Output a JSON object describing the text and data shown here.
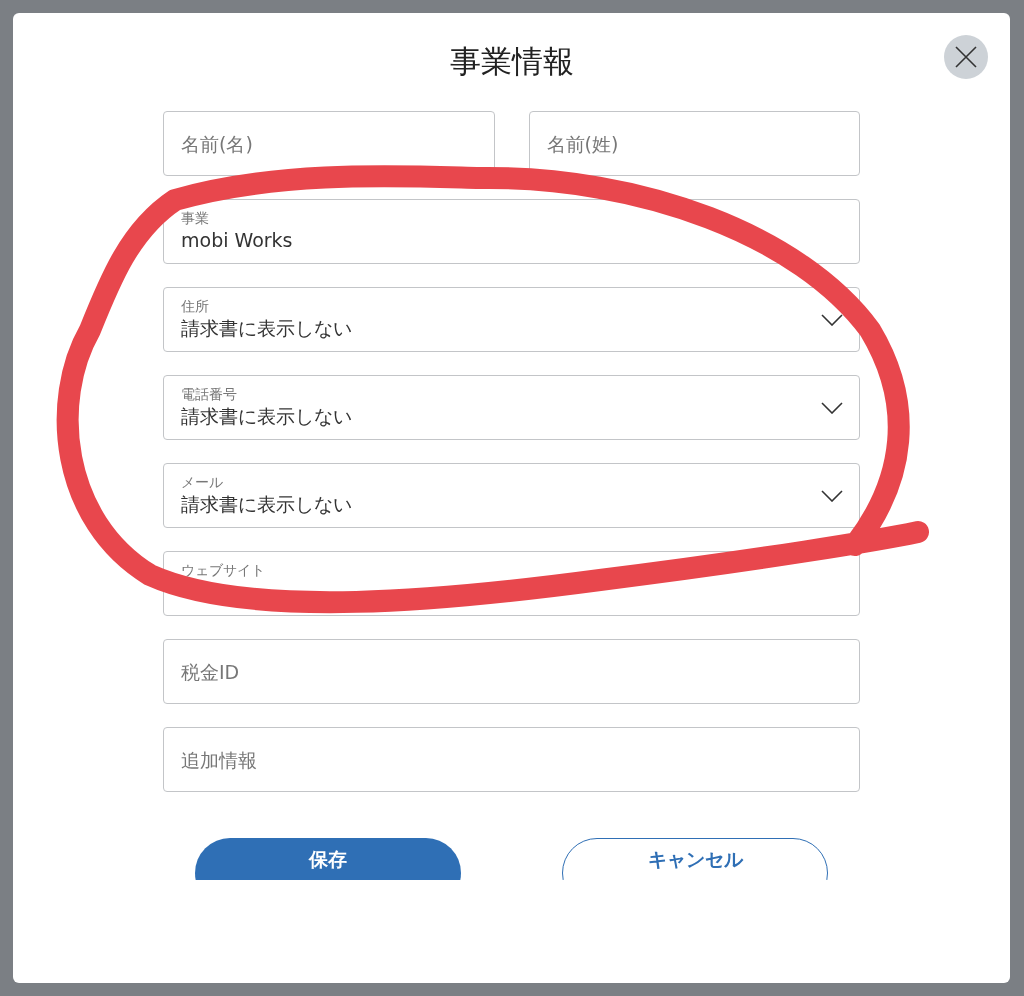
{
  "dialog": {
    "title": "事業情報"
  },
  "name_fields": [
    {
      "placeholder": "名前(名)"
    },
    {
      "placeholder": "名前(姓)"
    }
  ],
  "fields": [
    {
      "kind": "text",
      "label": "事業",
      "value": "mobi Works"
    },
    {
      "kind": "select",
      "label": "住所",
      "value": "請求書に表示しない"
    },
    {
      "kind": "select",
      "label": "電話番号",
      "value": "請求書に表示しない"
    },
    {
      "kind": "select",
      "label": "メール",
      "value": "請求書に表示しない"
    },
    {
      "kind": "text",
      "label": "ウェブサイト"
    },
    {
      "kind": "text",
      "placeholder": "税金ID"
    },
    {
      "kind": "text",
      "placeholder": "追加情報"
    }
  ],
  "buttons": [
    {
      "kind": "primary",
      "label": "保存"
    },
    {
      "kind": "secondary",
      "label": "キャンセル"
    }
  ]
}
